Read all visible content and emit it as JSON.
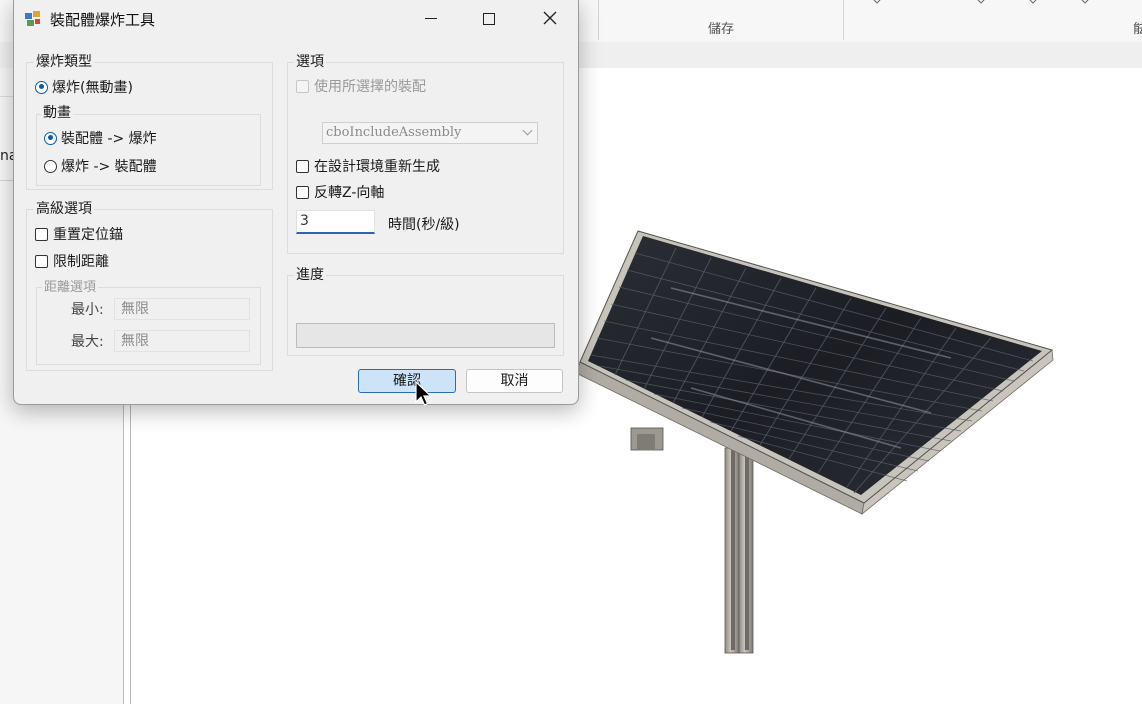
{
  "background_app": {
    "ribbon_group_label": "儲存",
    "ribbon_group_label_cut": "䏻",
    "left_panel_truncated_text": "na"
  },
  "dialog": {
    "title": "裝配體爆炸工具",
    "window_controls": {
      "minimize": "minimize-icon",
      "maximize": "maximize-icon",
      "close": "close-icon"
    },
    "explode_type": {
      "title": "爆炸類型",
      "explode_radio": "爆炸(無動畫)",
      "animation": {
        "title": "動畫",
        "assemble_to_explode": "裝配體 -> 爆炸",
        "explode_to_assemble": "爆炸 -> 裝配體"
      }
    },
    "advanced": {
      "title": "高級選項",
      "reposition_anchor": "重置定位錨",
      "limit_distance": "限制距離",
      "distance_options": {
        "title": "距離選項",
        "min_label": "最小:",
        "min_value": "無限",
        "max_label": "最大:",
        "max_value": "無限"
      }
    },
    "options": {
      "title": "選項",
      "use_selected_assembly": "使用所選擇的裝配",
      "combo_value": "cboIncludeAssembly",
      "regenerate_in_design": "在設計環境重新生成",
      "reverse_z": "反轉Z-向軸",
      "time_value": "3",
      "time_label": "時間(秒/級)"
    },
    "progress": {
      "title": "進度",
      "value": 0
    },
    "buttons": {
      "ok": "確認",
      "cancel": "取消"
    }
  },
  "colors": {
    "accent": "#0b5cad",
    "ok_button_bg": "#cde3f7",
    "ok_button_border": "#2a6bb8"
  }
}
